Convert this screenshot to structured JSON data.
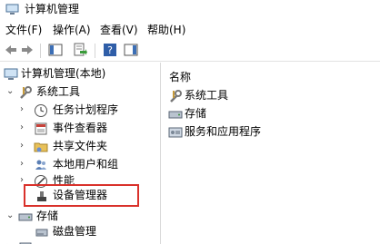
{
  "window": {
    "title": "计算机管理"
  },
  "menu": [
    {
      "label": "文件(F)"
    },
    {
      "label": "操作(A)"
    },
    {
      "label": "查看(V)"
    },
    {
      "label": "帮助(H)"
    }
  ],
  "toolbar": {
    "buttons": [
      "back-arrow",
      "forward-arrow",
      "show-hide-console-tree",
      "export-list",
      "help",
      "show-hide-action-pane"
    ]
  },
  "tree": {
    "root": "计算机管理(本地)",
    "system_tools": "系统工具",
    "items": [
      {
        "label": "任务计划程序",
        "icon": "clock-icon"
      },
      {
        "label": "事件查看器",
        "icon": "event-viewer-icon"
      },
      {
        "label": "共享文件夹",
        "icon": "shared-folder-icon"
      },
      {
        "label": "本地用户和组",
        "icon": "users-icon"
      },
      {
        "label": "性能",
        "icon": "performance-icon"
      },
      {
        "label": "设备管理器",
        "icon": "device-manager-icon"
      }
    ],
    "storage": "存储",
    "storage_items": [
      {
        "label": "磁盘管理",
        "icon": "disk-management-icon"
      }
    ]
  },
  "list": {
    "header": "名称",
    "rows": [
      {
        "label": "系统工具",
        "icon": "tools-icon"
      },
      {
        "label": "存储",
        "icon": "storage-icon"
      },
      {
        "label": "服务和应用程序",
        "icon": "services-icon"
      }
    ]
  },
  "colors": {
    "highlight": "#d9312b",
    "pane_border": "#d9d9d9"
  }
}
